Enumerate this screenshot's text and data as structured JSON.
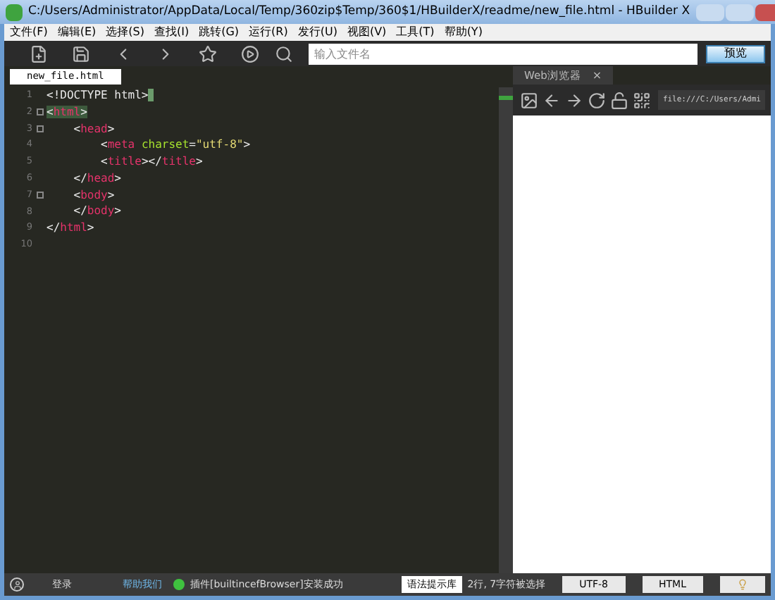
{
  "window": {
    "title": "C:/Users/Administrator/AppData/Local/Temp/360zip$Temp/360$1/HBuilderX/readme/new_file.html - HBuilder X"
  },
  "menu": [
    "文件(F)",
    "编辑(E)",
    "选择(S)",
    "查找(I)",
    "跳转(G)",
    "运行(R)",
    "发行(U)",
    "视图(V)",
    "工具(T)",
    "帮助(Y)"
  ],
  "toolbar": {
    "search": {
      "placeholder": "输入文件名"
    },
    "preview_button": "预览"
  },
  "tabs": [
    {
      "label": "new_file.html",
      "selected": true
    }
  ],
  "editor": {
    "lines": [
      {
        "number": "1",
        "fold": false,
        "tokens": [
          {
            "text": "<!DOCTYPE html>",
            "kind": "plain",
            "highlighted": false
          }
        ]
      },
      {
        "number": "2",
        "fold": true,
        "tokens": [
          {
            "text": "<",
            "kind": "punct",
            "highlighted": true
          },
          {
            "text": "html",
            "kind": "tag",
            "highlighted": true
          },
          {
            "text": ">",
            "kind": "punct",
            "highlighted": true
          }
        ]
      },
      {
        "number": "3",
        "fold": true,
        "tokens": [
          {
            "text": "    <",
            "kind": "punct",
            "highlighted": false
          },
          {
            "text": "head",
            "kind": "tag",
            "highlighted": false
          },
          {
            "text": ">",
            "kind": "punct",
            "highlighted": false
          }
        ]
      },
      {
        "number": "4",
        "fold": false,
        "tokens": [
          {
            "text": "        <",
            "kind": "punct",
            "highlighted": false
          },
          {
            "text": "meta",
            "kind": "tag",
            "highlighted": false
          },
          {
            "text": " charset",
            "kind": "attr",
            "highlighted": false
          },
          {
            "text": "=",
            "kind": "punct",
            "highlighted": false
          },
          {
            "text": "\"utf-8\"",
            "kind": "string",
            "highlighted": false
          },
          {
            "text": ">",
            "kind": "punct",
            "highlighted": false
          }
        ]
      },
      {
        "number": "5",
        "fold": false,
        "tokens": [
          {
            "text": "        <",
            "kind": "punct",
            "highlighted": false
          },
          {
            "text": "title",
            "kind": "tag",
            "highlighted": false
          },
          {
            "text": "></",
            "kind": "punct",
            "highlighted": false
          },
          {
            "text": "title",
            "kind": "tag",
            "highlighted": false
          },
          {
            "text": ">",
            "kind": "punct",
            "highlighted": false
          }
        ]
      },
      {
        "number": "6",
        "fold": false,
        "tokens": [
          {
            "text": "    </",
            "kind": "punct",
            "highlighted": false
          },
          {
            "text": "head",
            "kind": "tag",
            "highlighted": false
          },
          {
            "text": ">",
            "kind": "punct",
            "highlighted": false
          }
        ]
      },
      {
        "number": "7",
        "fold": true,
        "tokens": [
          {
            "text": "    <",
            "kind": "punct",
            "highlighted": false
          },
          {
            "text": "body",
            "kind": "tag",
            "highlighted": false
          },
          {
            "text": ">",
            "kind": "punct",
            "highlighted": false
          }
        ]
      },
      {
        "number": "8",
        "fold": false,
        "tokens": [
          {
            "text": "    </",
            "kind": "punct",
            "highlighted": false
          },
          {
            "text": "body",
            "kind": "tag",
            "highlighted": false
          },
          {
            "text": ">",
            "kind": "punct",
            "highlighted": false
          }
        ]
      },
      {
        "number": "9",
        "fold": false,
        "tokens": [
          {
            "text": "</",
            "kind": "punct",
            "highlighted": false
          },
          {
            "text": "html",
            "kind": "tag",
            "highlighted": false
          },
          {
            "text": ">",
            "kind": "punct",
            "highlighted": false
          }
        ]
      },
      {
        "number": "10",
        "fold": false
      }
    ]
  },
  "browser": {
    "tab": "Web浏览器",
    "close": "×",
    "address": "file:///C:/Users/Admi"
  },
  "status_bar": {
    "login": "登录",
    "help": "帮助我们",
    "message": "插件[builtincefBrowser]安装成功",
    "syntax_button": "语法提示库",
    "selection": "2行, 7字符被选择",
    "encoding": "UTF-8",
    "language": "HTML"
  }
}
